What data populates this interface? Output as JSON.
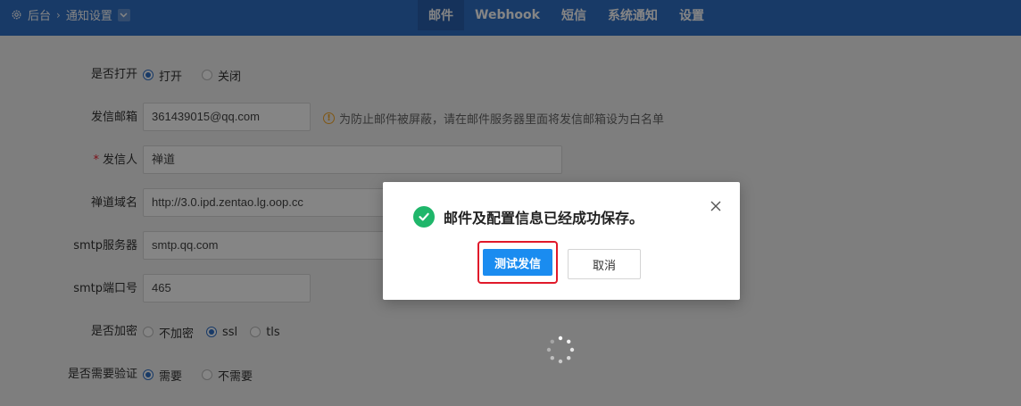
{
  "header": {
    "breadcrumb_root": "后台",
    "breadcrumb_current": "通知设置",
    "tabs": [
      {
        "label": "邮件",
        "active": true
      },
      {
        "label": "Webhook",
        "active": false
      },
      {
        "label": "短信",
        "active": false
      },
      {
        "label": "系统通知",
        "active": false
      },
      {
        "label": "设置",
        "active": false
      }
    ]
  },
  "form": {
    "enable": {
      "label": "是否打开",
      "options": [
        "打开",
        "关闭"
      ],
      "selected": "打开"
    },
    "sender_email": {
      "label": "发信邮箱",
      "value": "361439015@qq.com",
      "hint": "为防止邮件被屏蔽，请在邮件服务器里面将发信邮箱设为白名单"
    },
    "sender_name": {
      "label": "发信人",
      "required": true,
      "value": "禅道"
    },
    "domain": {
      "label": "禅道域名",
      "value": "http://3.0.ipd.zentao.lg.oop.cc"
    },
    "smtp_server": {
      "label": "smtp服务器",
      "value": "smtp.qq.com"
    },
    "smtp_port": {
      "label": "smtp端口号",
      "value": "465"
    },
    "encryption": {
      "label": "是否加密",
      "options": [
        "不加密",
        "ssl",
        "tls"
      ],
      "selected": "ssl"
    },
    "auth": {
      "label": "是否需要验证",
      "options": [
        "需要",
        "不需要"
      ],
      "selected": "需要"
    }
  },
  "dialog": {
    "message": "邮件及配置信息已经成功保存。",
    "primary_button": "测试发信",
    "cancel_button": "取消"
  },
  "colors": {
    "header_bg": "#2f6fc6",
    "primary_button": "#1a8cf0",
    "success_icon": "#1fb66a",
    "highlight_border": "#e0192a"
  }
}
